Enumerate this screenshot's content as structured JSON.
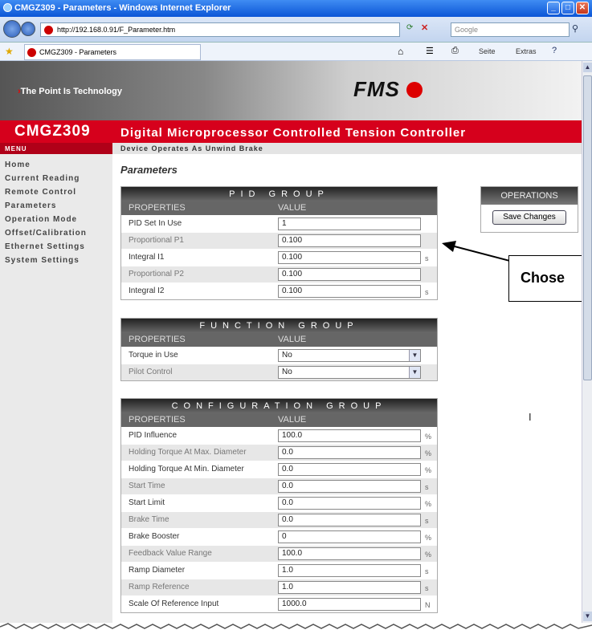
{
  "window": {
    "title": "CMGZ309 - Parameters - Windows Internet Explorer"
  },
  "browser": {
    "url": "http://192.168.0.91/F_Parameter.htm",
    "search_placeholder": "Google",
    "tab_label": "CMGZ309 - Parameters",
    "toolbar": {
      "page": "Seite",
      "extras": "Extras"
    }
  },
  "banner": {
    "slogan": "The Point Is Technology",
    "logo": "FMS"
  },
  "device": {
    "name": "CMGZ309"
  },
  "menu": {
    "header": "MENU",
    "items": [
      "Home",
      "Current Reading",
      "Remote Control",
      "Parameters",
      "Operation Mode",
      "Offset/Calibration",
      "Ethernet Settings",
      "System Settings"
    ]
  },
  "header": {
    "title": "Digital Microprocessor Controlled Tension Controller",
    "subtitle": "Device Operates As Unwind Brake"
  },
  "page_title": "Parameters",
  "columns": {
    "properties": "PROPERTIES",
    "value": "VALUE"
  },
  "pid_group": {
    "title": "PID GROUP",
    "rows": [
      {
        "label": "PID Set In Use",
        "value": "1",
        "unit": ""
      },
      {
        "label": "Proportional P1",
        "value": "0.100",
        "unit": ""
      },
      {
        "label": "Integral I1",
        "value": "0.100",
        "unit": "s"
      },
      {
        "label": "Proportional P2",
        "value": "0.100",
        "unit": ""
      },
      {
        "label": "Integral I2",
        "value": "0.100",
        "unit": "s"
      }
    ]
  },
  "function_group": {
    "title": "FUNCTION GROUP",
    "rows": [
      {
        "label": "Torque in Use",
        "value": "No"
      },
      {
        "label": "Pilot Control",
        "value": "No"
      }
    ]
  },
  "configuration_group": {
    "title": "CONFIGURATION GROUP",
    "rows": [
      {
        "label": "PID Influence",
        "value": "100.0",
        "unit": "%"
      },
      {
        "label": "Holding Torque At Max. Diameter",
        "value": "0.0",
        "unit": "%"
      },
      {
        "label": "Holding Torque At Min. Diameter",
        "value": "0.0",
        "unit": "%"
      },
      {
        "label": "Start Time",
        "value": "0.0",
        "unit": "s"
      },
      {
        "label": "Start Limit",
        "value": "0.0",
        "unit": "%"
      },
      {
        "label": "Brake Time",
        "value": "0.0",
        "unit": "s"
      },
      {
        "label": "Brake Booster",
        "value": "0",
        "unit": "%"
      },
      {
        "label": "Feedback Value Range",
        "value": "100.0",
        "unit": "%"
      },
      {
        "label": "Ramp Diameter",
        "value": "1.0",
        "unit": "s"
      },
      {
        "label": "Ramp Reference",
        "value": "1.0",
        "unit": "s"
      },
      {
        "label": "Scale Of Reference Input",
        "value": "1000.0",
        "unit": "N"
      }
    ]
  },
  "operations": {
    "title": "OPERATIONS",
    "save_label": "Save Changes"
  },
  "callout": {
    "text": "Chose"
  }
}
